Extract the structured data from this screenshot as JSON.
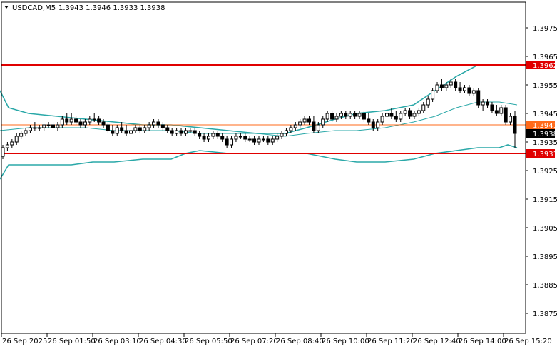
{
  "header": {
    "symbol": "USDCAD,M5",
    "ohlc": "1.3943 1.3946 1.3933 1.3938"
  },
  "chart_data": {
    "type": "candlestick",
    "ylim": [
      1.3868,
      1.3984
    ],
    "y_ticks": [
      "1.3975",
      "1.3965",
      "1.3955",
      "1.3945",
      "1.3935",
      "1.3925",
      "1.3915",
      "1.3905",
      "1.3895",
      "1.3885",
      "1.3875"
    ],
    "x_ticks": [
      "26 Sep 2025",
      "26 Sep 01:50",
      "26 Sep 03:10",
      "26 Sep 04:30",
      "26 Sep 05:50",
      "26 Sep 07:20",
      "26 Sep 08:40",
      "26 Sep 10:00",
      "26 Sep 11:20",
      "26 Sep 12:40",
      "26 Sep 14:00",
      "26 Sep 15:20"
    ],
    "current_price": "1.3938",
    "levels": [
      {
        "price": "1.3962",
        "color": "#e00000",
        "style": "thick"
      },
      {
        "price": "1.3941",
        "color": "#ff6a1a",
        "style": "thin"
      },
      {
        "price": "1.3931",
        "color": "#e00000",
        "style": "thick"
      }
    ],
    "bollinger_upper": [
      [
        0,
        1.3953
      ],
      [
        12,
        1.3947
      ],
      [
        40,
        1.3945
      ],
      [
        80,
        1.3944
      ],
      [
        120,
        1.3943
      ],
      [
        160,
        1.3942
      ],
      [
        200,
        1.3941
      ],
      [
        240,
        1.3941
      ],
      [
        280,
        1.394
      ],
      [
        320,
        1.3939
      ],
      [
        360,
        1.3938
      ],
      [
        400,
        1.3938
      ],
      [
        430,
        1.394
      ],
      [
        470,
        1.3943
      ],
      [
        500,
        1.3945
      ],
      [
        540,
        1.3946
      ],
      [
        580,
        1.3948
      ],
      [
        610,
        1.3953
      ],
      [
        640,
        1.3958
      ],
      [
        670,
        1.3962
      ],
      [
        700,
        1.3962
      ],
      [
        737,
        1.3962
      ]
    ],
    "bollinger_mid": [
      [
        0,
        1.3939
      ],
      [
        40,
        1.394
      ],
      [
        80,
        1.394
      ],
      [
        120,
        1.394
      ],
      [
        160,
        1.3939
      ],
      [
        200,
        1.3939
      ],
      [
        240,
        1.3939
      ],
      [
        280,
        1.3938
      ],
      [
        320,
        1.3938
      ],
      [
        360,
        1.3938
      ],
      [
        400,
        1.3937
      ],
      [
        430,
        1.3938
      ],
      [
        470,
        1.3939
      ],
      [
        500,
        1.3939
      ],
      [
        540,
        1.394
      ],
      [
        580,
        1.3942
      ],
      [
        610,
        1.3944
      ],
      [
        640,
        1.3947
      ],
      [
        670,
        1.3949
      ],
      [
        700,
        1.3949
      ],
      [
        725,
        1.3948
      ]
    ],
    "bollinger_lower": [
      [
        0,
        1.3922
      ],
      [
        12,
        1.3927
      ],
      [
        40,
        1.3927
      ],
      [
        80,
        1.3927
      ],
      [
        100,
        1.3927
      ],
      [
        130,
        1.3928
      ],
      [
        160,
        1.3928
      ],
      [
        200,
        1.3929
      ],
      [
        240,
        1.3929
      ],
      [
        260,
        1.3931
      ],
      [
        280,
        1.3932
      ],
      [
        320,
        1.3931
      ],
      [
        360,
        1.3931
      ],
      [
        400,
        1.3931
      ],
      [
        430,
        1.3931
      ],
      [
        470,
        1.3929
      ],
      [
        500,
        1.3928
      ],
      [
        540,
        1.3928
      ],
      [
        580,
        1.3929
      ],
      [
        610,
        1.3931
      ],
      [
        640,
        1.3932
      ],
      [
        670,
        1.3933
      ],
      [
        700,
        1.3933
      ],
      [
        712,
        1.3934
      ],
      [
        725,
        1.3933
      ]
    ],
    "candles": [
      [
        1.393,
        1.3934,
        1.3929,
        1.3933
      ],
      [
        1.3933,
        1.3935,
        1.3932,
        1.3934
      ],
      [
        1.3934,
        1.3936,
        1.3933,
        1.3935
      ],
      [
        1.3935,
        1.3938,
        1.3934,
        1.3937
      ],
      [
        1.3937,
        1.3939,
        1.3936,
        1.3938
      ],
      [
        1.3938,
        1.394,
        1.3937,
        1.3939
      ],
      [
        1.3939,
        1.3941,
        1.3938,
        1.394
      ],
      [
        1.394,
        1.3942,
        1.3939,
        1.394
      ],
      [
        1.394,
        1.3941,
        1.3939,
        1.394
      ],
      [
        1.394,
        1.3941,
        1.3939,
        1.3941
      ],
      [
        1.3941,
        1.3942,
        1.394,
        1.3941
      ],
      [
        1.3941,
        1.3942,
        1.394,
        1.394
      ],
      [
        1.394,
        1.3942,
        1.3939,
        1.3941
      ],
      [
        1.3941,
        1.3944,
        1.394,
        1.3943
      ],
      [
        1.3943,
        1.3945,
        1.3941,
        1.3942
      ],
      [
        1.3942,
        1.3945,
        1.3941,
        1.3943
      ],
      [
        1.3943,
        1.3944,
        1.3941,
        1.3942
      ],
      [
        1.3942,
        1.3943,
        1.394,
        1.3941
      ],
      [
        1.3941,
        1.3943,
        1.394,
        1.3942
      ],
      [
        1.3942,
        1.3944,
        1.3941,
        1.3943
      ],
      [
        1.3943,
        1.3945,
        1.3942,
        1.3943
      ],
      [
        1.3943,
        1.3944,
        1.3941,
        1.3942
      ],
      [
        1.3942,
        1.3943,
        1.394,
        1.3941
      ],
      [
        1.3941,
        1.3942,
        1.3938,
        1.3939
      ],
      [
        1.3939,
        1.3941,
        1.3937,
        1.3938
      ],
      [
        1.3938,
        1.3941,
        1.3937,
        1.394
      ],
      [
        1.394,
        1.3942,
        1.3938,
        1.3939
      ],
      [
        1.3939,
        1.3941,
        1.3937,
        1.3938
      ],
      [
        1.3938,
        1.394,
        1.3937,
        1.3939
      ],
      [
        1.3939,
        1.3941,
        1.3938,
        1.394
      ],
      [
        1.394,
        1.3941,
        1.3938,
        1.3939
      ],
      [
        1.3939,
        1.3941,
        1.3938,
        1.394
      ],
      [
        1.394,
        1.3942,
        1.3939,
        1.3941
      ],
      [
        1.3941,
        1.3943,
        1.394,
        1.3942
      ],
      [
        1.3942,
        1.3943,
        1.394,
        1.3941
      ],
      [
        1.3941,
        1.3942,
        1.3939,
        1.394
      ],
      [
        1.394,
        1.3941,
        1.3938,
        1.3939
      ],
      [
        1.3939,
        1.394,
        1.3937,
        1.3938
      ],
      [
        1.3938,
        1.394,
        1.3937,
        1.3939
      ],
      [
        1.3939,
        1.394,
        1.3937,
        1.3938
      ],
      [
        1.3938,
        1.394,
        1.3937,
        1.3939
      ],
      [
        1.3939,
        1.394,
        1.3938,
        1.3939
      ],
      [
        1.3939,
        1.394,
        1.3937,
        1.3938
      ],
      [
        1.3938,
        1.3939,
        1.3936,
        1.3937
      ],
      [
        1.3937,
        1.3938,
        1.3935,
        1.3936
      ],
      [
        1.3936,
        1.3938,
        1.3935,
        1.3937
      ],
      [
        1.3937,
        1.3939,
        1.3936,
        1.3938
      ],
      [
        1.3938,
        1.3939,
        1.3936,
        1.3937
      ],
      [
        1.3937,
        1.3938,
        1.3935,
        1.3936
      ],
      [
        1.3936,
        1.3937,
        1.3933,
        1.3934
      ],
      [
        1.3934,
        1.3937,
        1.3933,
        1.3936
      ],
      [
        1.3936,
        1.3938,
        1.3935,
        1.3937
      ],
      [
        1.3937,
        1.3938,
        1.3936,
        1.3937
      ],
      [
        1.3937,
        1.3938,
        1.3935,
        1.3936
      ],
      [
        1.3936,
        1.3937,
        1.3935,
        1.3936
      ],
      [
        1.3936,
        1.3937,
        1.3934,
        1.3935
      ],
      [
        1.3935,
        1.3937,
        1.3934,
        1.3936
      ],
      [
        1.3936,
        1.3937,
        1.3935,
        1.3936
      ],
      [
        1.3936,
        1.3937,
        1.3934,
        1.3935
      ],
      [
        1.3935,
        1.3937,
        1.3934,
        1.3936
      ],
      [
        1.3936,
        1.3938,
        1.3935,
        1.3937
      ],
      [
        1.3937,
        1.3939,
        1.3936,
        1.3938
      ],
      [
        1.3938,
        1.394,
        1.3937,
        1.3939
      ],
      [
        1.3939,
        1.3941,
        1.3938,
        1.394
      ],
      [
        1.394,
        1.3942,
        1.3939,
        1.3941
      ],
      [
        1.3941,
        1.3943,
        1.394,
        1.3942
      ],
      [
        1.3942,
        1.3944,
        1.3941,
        1.3943
      ],
      [
        1.3943,
        1.3944,
        1.3941,
        1.3942
      ],
      [
        1.3942,
        1.3944,
        1.3938,
        1.3939
      ],
      [
        1.3939,
        1.3942,
        1.3938,
        1.3941
      ],
      [
        1.3941,
        1.3944,
        1.394,
        1.3943
      ],
      [
        1.3943,
        1.3946,
        1.3942,
        1.3945
      ],
      [
        1.3945,
        1.3946,
        1.3942,
        1.3943
      ],
      [
        1.3943,
        1.3945,
        1.3942,
        1.3944
      ],
      [
        1.3944,
        1.3946,
        1.3943,
        1.3945
      ],
      [
        1.3945,
        1.3946,
        1.3943,
        1.3944
      ],
      [
        1.3944,
        1.3946,
        1.3943,
        1.3945
      ],
      [
        1.3945,
        1.3946,
        1.3943,
        1.3944
      ],
      [
        1.3944,
        1.3946,
        1.3943,
        1.3945
      ],
      [
        1.3945,
        1.3946,
        1.3942,
        1.3943
      ],
      [
        1.3943,
        1.3945,
        1.3941,
        1.3942
      ],
      [
        1.3942,
        1.3943,
        1.3939,
        1.394
      ],
      [
        1.394,
        1.3943,
        1.3939,
        1.3942
      ],
      [
        1.3942,
        1.3945,
        1.3941,
        1.3944
      ],
      [
        1.3944,
        1.3946,
        1.3943,
        1.3945
      ],
      [
        1.3945,
        1.3947,
        1.3943,
        1.3944
      ],
      [
        1.3944,
        1.3946,
        1.3942,
        1.3943
      ],
      [
        1.3943,
        1.3946,
        1.3942,
        1.3945
      ],
      [
        1.3945,
        1.3947,
        1.3944,
        1.3946
      ],
      [
        1.3946,
        1.3947,
        1.3943,
        1.3944
      ],
      [
        1.3944,
        1.3946,
        1.3943,
        1.3945
      ],
      [
        1.3945,
        1.3947,
        1.3944,
        1.3946
      ],
      [
        1.3946,
        1.3949,
        1.3945,
        1.3948
      ],
      [
        1.3948,
        1.3951,
        1.3947,
        1.395
      ],
      [
        1.395,
        1.3954,
        1.3949,
        1.3953
      ],
      [
        1.3953,
        1.3956,
        1.3952,
        1.3955
      ],
      [
        1.3955,
        1.3957,
        1.3953,
        1.3954
      ],
      [
        1.3954,
        1.3956,
        1.3953,
        1.3955
      ],
      [
        1.3955,
        1.3957,
        1.3954,
        1.3956
      ],
      [
        1.3956,
        1.3957,
        1.3953,
        1.3954
      ],
      [
        1.3954,
        1.3956,
        1.3952,
        1.3953
      ],
      [
        1.3953,
        1.3955,
        1.3952,
        1.3954
      ],
      [
        1.3954,
        1.3955,
        1.3951,
        1.3952
      ],
      [
        1.3952,
        1.3954,
        1.3951,
        1.3953
      ],
      [
        1.3953,
        1.3954,
        1.3947,
        1.3948
      ],
      [
        1.3948,
        1.395,
        1.3946,
        1.3949
      ],
      [
        1.3949,
        1.395,
        1.3947,
        1.3948
      ],
      [
        1.3948,
        1.3949,
        1.3945,
        1.3946
      ],
      [
        1.3946,
        1.3948,
        1.3944,
        1.3945
      ],
      [
        1.3945,
        1.3948,
        1.3944,
        1.3947
      ],
      [
        1.3947,
        1.3948,
        1.3941,
        1.3942
      ],
      [
        1.3942,
        1.3945,
        1.3941,
        1.3944
      ],
      [
        1.3944,
        1.3946,
        1.3933,
        1.3938
      ]
    ]
  }
}
